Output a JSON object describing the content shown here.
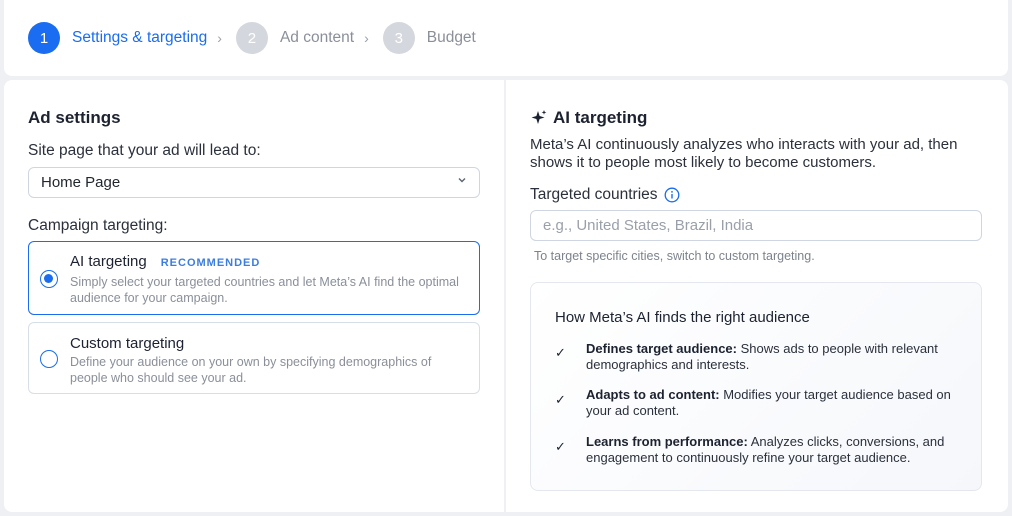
{
  "stepper": {
    "steps": [
      {
        "num": "1",
        "label": "Settings & targeting"
      },
      {
        "num": "2",
        "label": "Ad content"
      },
      {
        "num": "3",
        "label": "Budget"
      }
    ]
  },
  "ad_settings": {
    "title": "Ad settings",
    "site_page_label": "Site page that your ad will lead to:",
    "site_page_value": "Home Page",
    "campaign_label": "Campaign targeting:",
    "options": [
      {
        "title": "AI targeting",
        "badge": "RECOMMENDED",
        "desc": "Simply select your targeted countries and let Meta’s AI find the optimal audience for your campaign.",
        "selected": true
      },
      {
        "title": "Custom targeting",
        "desc": "Define your audience on your own by specifying demographics of people who should see your ad.",
        "selected": false
      }
    ]
  },
  "ai_targeting": {
    "title": "AI targeting",
    "description": "Meta’s AI continuously analyzes who interacts with your ad, then shows it to people most likely to become customers.",
    "countries_label": "Targeted countries",
    "countries_placeholder": "e.g., United States, Brazil, India",
    "hint": "To target specific cities, switch to custom targeting.",
    "info_title": "How Meta’s AI finds the right audience",
    "bullets": [
      {
        "bold": "Defines target audience:",
        "text": " Shows ads to people with relevant demographics and interests."
      },
      {
        "bold": "Adapts to ad content:",
        "text": " Modifies your target audience based on your ad content."
      },
      {
        "bold": "Learns from performance:",
        "text": " Analyzes clicks, conversions, and engagement to continuously refine your target audience."
      }
    ]
  },
  "colors": {
    "accent": "#1a6cf0",
    "muted": "#8a8f99"
  },
  "icons": [
    "chevron-right-icon",
    "chevron-down-icon",
    "sparkle-icon",
    "info-icon",
    "check-icon"
  ]
}
